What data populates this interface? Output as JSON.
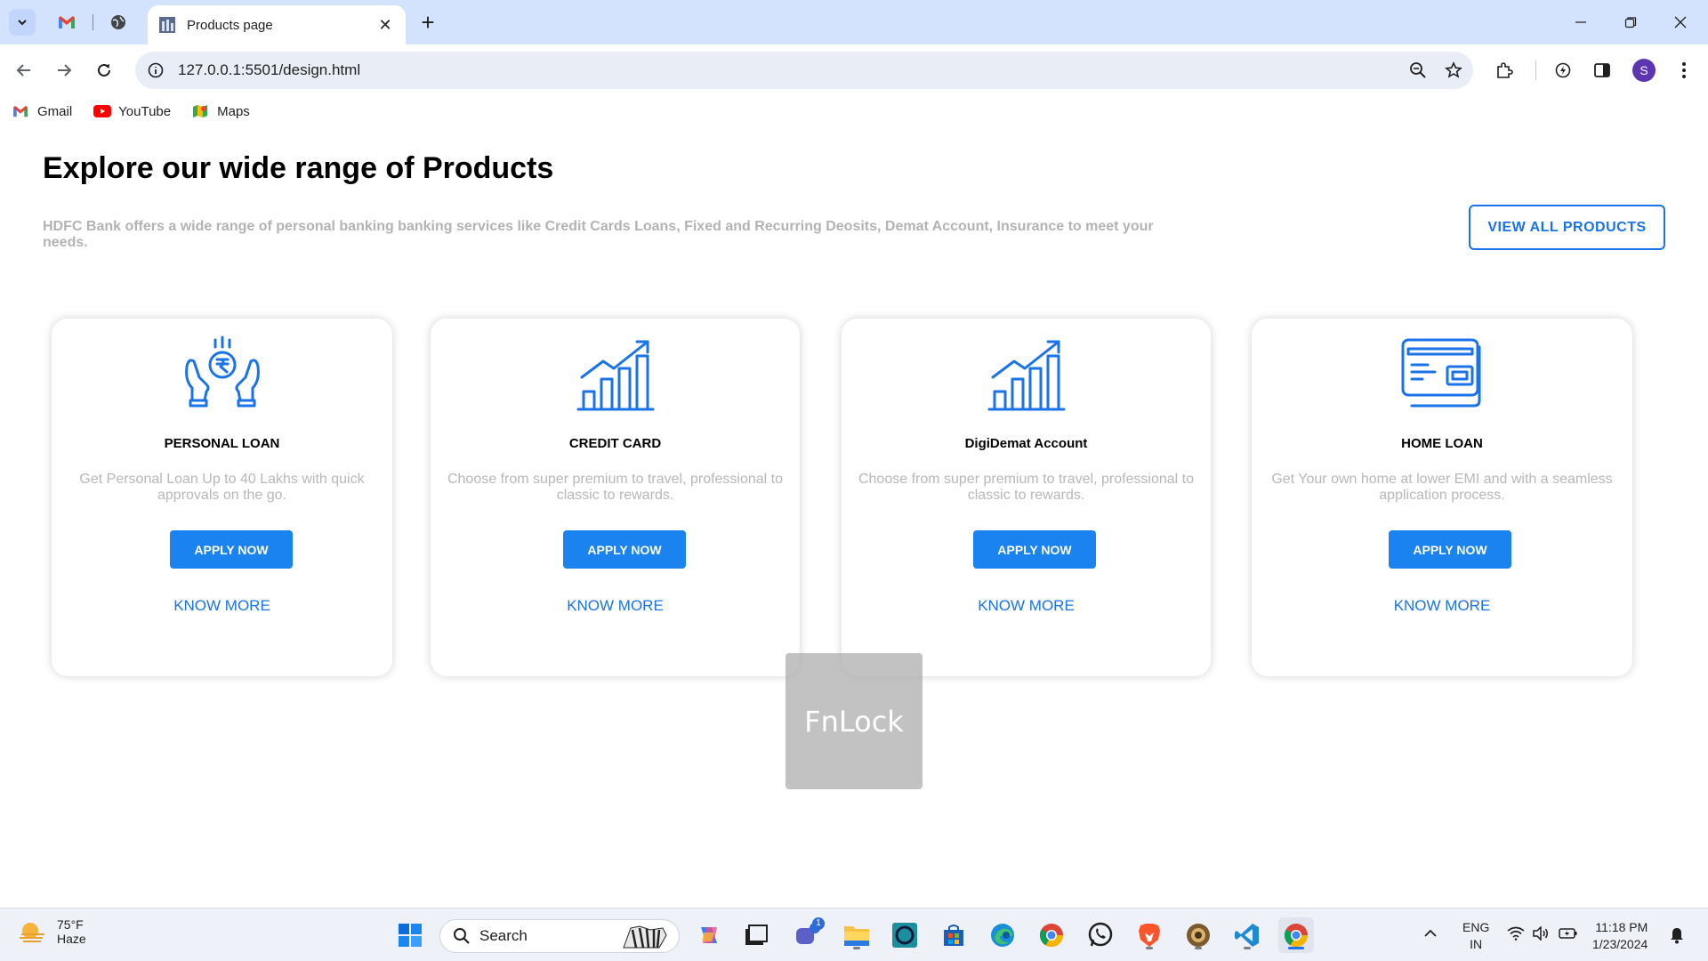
{
  "browser": {
    "active_tab_title": "Products page",
    "url": "127.0.0.1:5501/design.html",
    "profile_initial": "S",
    "bookmarks": [
      {
        "label": "Gmail",
        "icon": "gmail-icon"
      },
      {
        "label": "YouTube",
        "icon": "youtube-icon"
      },
      {
        "label": "Maps",
        "icon": "maps-icon"
      }
    ]
  },
  "page": {
    "title": "Explore our wide range of Products",
    "description": "HDFC Bank offers a wide range of personal banking banking services like Credit Cards Loans, Fixed and Recurring Deosits, Demat Account, Insurance to meet your needs.",
    "view_all_label": "VIEW ALL PRODUCTS",
    "cards": [
      {
        "title": "PERSONAL LOAN",
        "description": "Get Personal Loan Up to 40 Lakhs with quick approvals on the go.",
        "apply_label": "APPLY NOW",
        "know_more_label": "KNOW MORE",
        "icon": "rupee-hands-icon"
      },
      {
        "title": "CREDIT CARD",
        "description": "Choose from super premium to travel, professional to classic to rewards.",
        "apply_label": "APPLY NOW",
        "know_more_label": "KNOW MORE",
        "icon": "growth-chart-icon"
      },
      {
        "title": "DigiDemat Account",
        "description": "Choose from super premium to travel, professional to classic to rewards.",
        "apply_label": "APPLY NOW",
        "know_more_label": "KNOW MORE",
        "icon": "growth-chart-icon"
      },
      {
        "title": "HOME LOAN",
        "description": "Get Your own home at lower EMI and with a seamless application process.",
        "apply_label": "APPLY NOW",
        "know_more_label": "KNOW MORE",
        "icon": "credit-card-icon"
      }
    ]
  },
  "overlay": {
    "fnlock_label": "FnLock"
  },
  "taskbar": {
    "weather_temp": "75°F",
    "weather_condition": "Haze",
    "search_label": "Search",
    "teams_badge": "1",
    "language": "ENG",
    "region": "IN",
    "time": "11:18 PM",
    "date": "1/23/2024"
  },
  "colors": {
    "accent": "#1a73e8",
    "button": "#1a83f0",
    "tabbar": "#d3e3fd"
  }
}
